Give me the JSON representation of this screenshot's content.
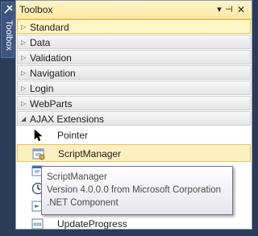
{
  "side_strip": {
    "tab_label": "Toolbox"
  },
  "window": {
    "title": "Toolbox",
    "dropdown_glyph": "▾",
    "pin_glyph": "⊣",
    "close_glyph": "✕"
  },
  "groups": [
    {
      "label": "Standard",
      "expanded": false,
      "selected": true
    },
    {
      "label": "Data",
      "expanded": false
    },
    {
      "label": "Validation",
      "expanded": false
    },
    {
      "label": "Navigation",
      "expanded": false
    },
    {
      "label": "Login",
      "expanded": false
    },
    {
      "label": "WebParts",
      "expanded": false
    },
    {
      "label": "AJAX Extensions",
      "expanded": true
    }
  ],
  "items": [
    {
      "label": "Pointer",
      "icon": "pointer-icon"
    },
    {
      "label": "ScriptManager",
      "icon": "script-manager-icon",
      "selected": true
    },
    {
      "label": "",
      "icon": "script-manager-proxy-icon"
    },
    {
      "label": "",
      "icon": "timer-icon"
    },
    {
      "label": "",
      "icon": "update-panel-icon"
    },
    {
      "label": "UpdateProgress",
      "icon": "update-progress-icon"
    }
  ],
  "tooltip": {
    "line1": "ScriptManager",
    "line2": "Version 4.0.0.0 from Microsoft Corporation",
    "line3": ".NET Component"
  },
  "colors": {
    "chrome": "#2b3c59",
    "selection": "#fcefc0",
    "selection_border": "#e5c365"
  }
}
